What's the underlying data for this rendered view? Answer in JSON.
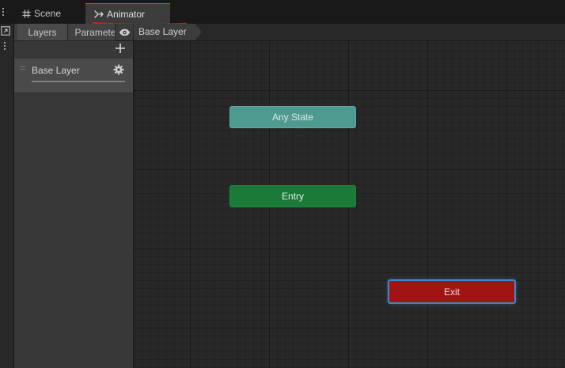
{
  "window": {
    "tabs": [
      {
        "label": "Scene",
        "icon": "grid-hash-icon",
        "active": false
      },
      {
        "label": "Animator",
        "icon": "animator-transition-icon",
        "active": true
      }
    ],
    "annotation_color": "#e01818"
  },
  "panel": {
    "tabs": [
      {
        "label": "Layers",
        "selected": true
      },
      {
        "label": "Parameters",
        "selected": false
      }
    ],
    "layers": [
      {
        "name": "Base Layer"
      }
    ]
  },
  "breadcrumb": {
    "items": [
      "Base Layer"
    ]
  },
  "graph": {
    "nodes": [
      {
        "label": "Any State",
        "color": "#4f9a90"
      },
      {
        "label": "Entry",
        "color": "#1a7a38"
      },
      {
        "label": "Exit",
        "color": "#a01414",
        "selected": true
      }
    ],
    "selection_color": "#3f85c9"
  }
}
